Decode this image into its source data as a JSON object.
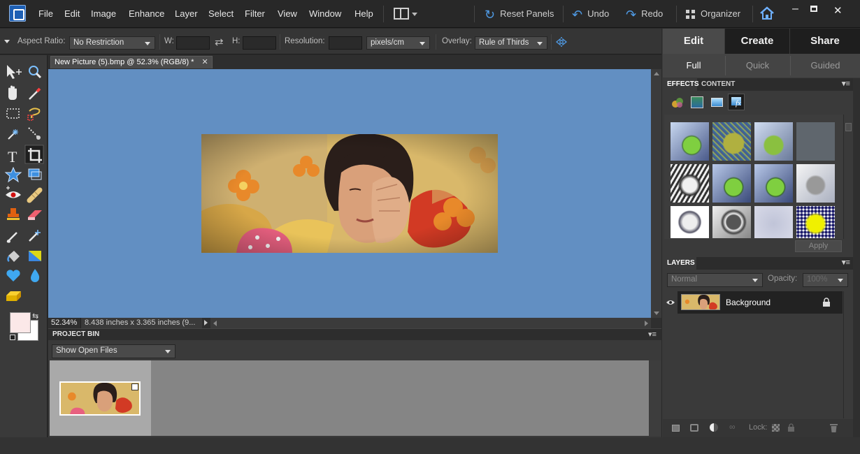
{
  "menubar": {
    "items": [
      "File",
      "Edit",
      "Image",
      "Enhance",
      "Layer",
      "Select",
      "Filter",
      "View",
      "Window",
      "Help"
    ],
    "reset_panels": "Reset Panels",
    "undo": "Undo",
    "redo": "Redo",
    "organizer": "Organizer"
  },
  "options": {
    "aspect_label": "Aspect Ratio:",
    "aspect_value": "No Restriction",
    "w_label": "W:",
    "h_label": "H:",
    "resolution_label": "Resolution:",
    "resolution_unit": "pixels/cm",
    "overlay_label": "Overlay:",
    "overlay_value": "Rule of Thirds"
  },
  "document": {
    "tab_title": "New Picture (5).bmp @ 52.3% (RGB/8) *",
    "zoom": "52.34%",
    "doc_size": "8.438 inches x 3.365 inches (9..."
  },
  "project_bin": {
    "title": "PROJECT BIN",
    "dropdown": "Show Open Files"
  },
  "right_panel": {
    "big_tabs": [
      "Edit",
      "Create",
      "Share"
    ],
    "sub_tabs": [
      "Full",
      "Quick",
      "Guided"
    ],
    "effects_tabs": [
      "EFFECTS",
      "CONTENT"
    ],
    "apply": "Apply",
    "layers_title": "LAYERS",
    "blend_mode": "Normal",
    "opacity_label": "Opacity:",
    "opacity_value": "100%",
    "layer_name": "Background",
    "lock_label": "Lock:"
  },
  "colors": {
    "canvas_bg": "#628fc2",
    "accent_blue": "#4f9be6"
  }
}
